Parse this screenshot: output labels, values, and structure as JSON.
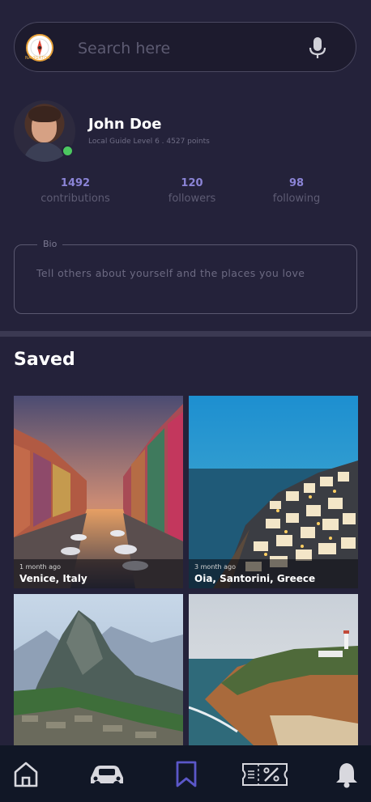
{
  "search": {
    "placeholder": "Search here",
    "logo_text": "NAVIGATOR",
    "logo_icon": "compass-logo-icon",
    "mic_icon": "microphone-icon"
  },
  "profile": {
    "name": "John Doe",
    "level": "Local Guide Level 6 . 4527 points",
    "online_color": "#4cc860"
  },
  "stats": [
    {
      "value": "1492",
      "label": "contributions"
    },
    {
      "value": "120",
      "label": "followers"
    },
    {
      "value": "98",
      "label": "following"
    }
  ],
  "bio": {
    "label": "Bio",
    "placeholder": "Tell others about yourself and the places you love"
  },
  "saved": {
    "title": "Saved",
    "items": [
      {
        "time": "1 month ago",
        "place": "Venice, Italy"
      },
      {
        "time": "3 month ago",
        "place": "Oia, Santorini, Greece"
      },
      {
        "time": "",
        "place": ""
      },
      {
        "time": "",
        "place": ""
      }
    ]
  },
  "nav": {
    "items": [
      "home-icon",
      "car-icon",
      "bookmark-icon",
      "ticket-icon",
      "bell-icon"
    ],
    "active": "bookmark-icon",
    "active_color": "#5b57c8"
  }
}
